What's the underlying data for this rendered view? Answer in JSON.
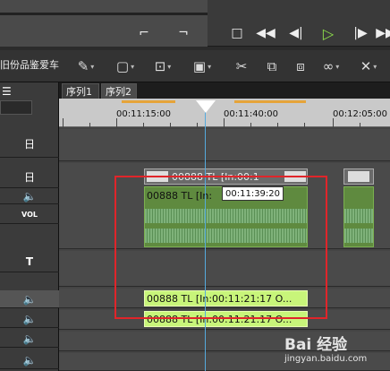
{
  "project": {
    "name": "旧份品鉴爱车"
  },
  "tabs": [
    {
      "label": "序列1"
    },
    {
      "label": "序列2"
    }
  ],
  "ruler": {
    "labels": [
      "00:11:15:00",
      "00:11:40:00",
      "00:12:05:00"
    ]
  },
  "tracks": {
    "t1": "日",
    "t2": "日",
    "t3": "VOL",
    "t4": "T"
  },
  "clips": {
    "video_label": "00888  TL [In:00:1",
    "audio_label": "00888  TL [In:",
    "sel1_label": "00888  TL [In:00:11:21:17 O...",
    "sel2_label": "00888  TL [In:00:11:21:17 O..."
  },
  "playhead": {
    "timecode": "00:11:39:20"
  },
  "watermark": {
    "text": "Bai 经验",
    "sub": "jingyan.baidu.com"
  },
  "colors": {
    "accent_play": "#8ee04b",
    "highlight": "#e0252a",
    "selected_clip": "#c8f57a",
    "audio_clip": "#5f8a3f"
  }
}
